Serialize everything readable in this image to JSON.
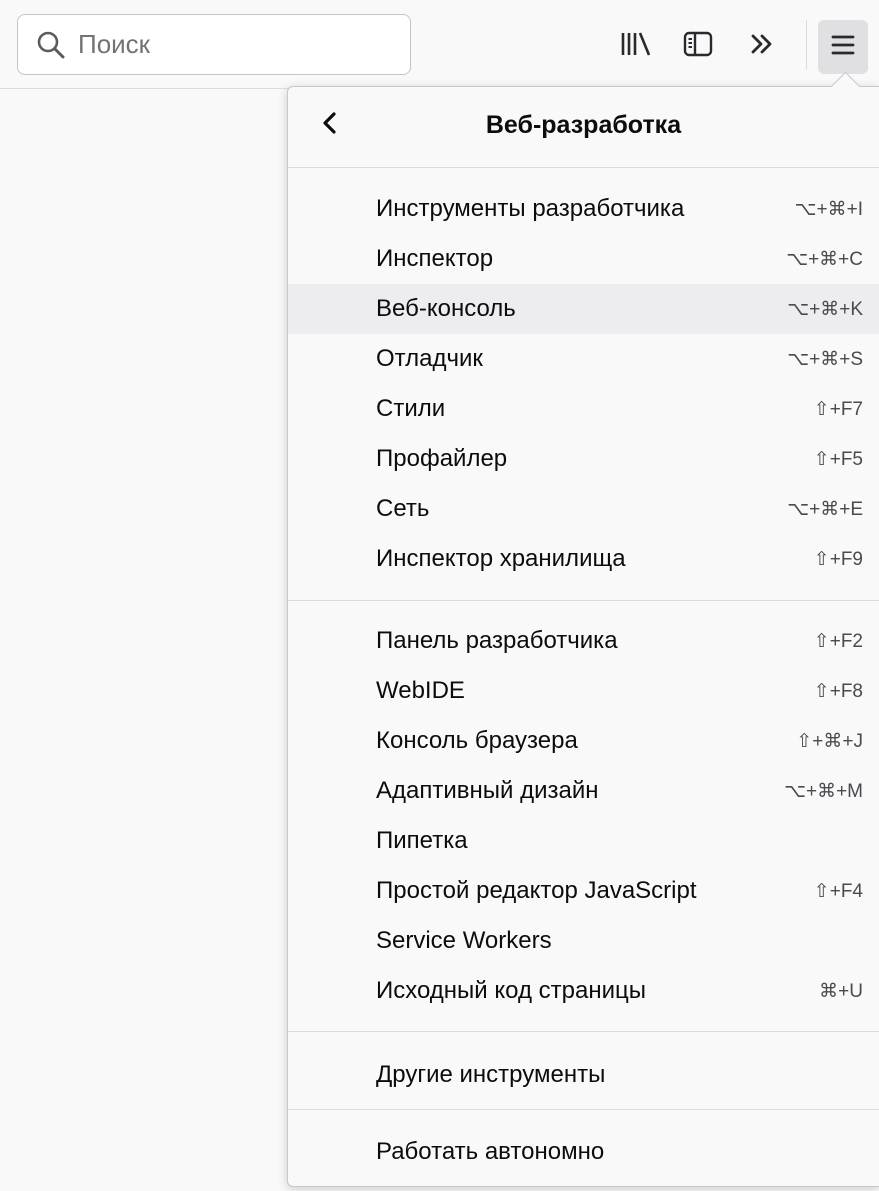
{
  "toolbar": {
    "search_placeholder": "Поиск",
    "icons": [
      "library-icon",
      "sidebar-icon",
      "overflow-chevron-icon",
      "hamburger-menu-icon"
    ]
  },
  "panel": {
    "title": "Веб-разработка",
    "groups": [
      {
        "items": [
          {
            "label": "Инструменты разработчика",
            "shortcut": "⌥+⌘+I"
          },
          {
            "label": "Инспектор",
            "shortcut": "⌥+⌘+C"
          },
          {
            "label": "Веб-консоль",
            "shortcut": "⌥+⌘+K",
            "highlighted": true
          },
          {
            "label": "Отладчик",
            "shortcut": "⌥+⌘+S"
          },
          {
            "label": "Стили",
            "shortcut": "⇧+F7"
          },
          {
            "label": "Профайлер",
            "shortcut": "⇧+F5"
          },
          {
            "label": "Сеть",
            "shortcut": "⌥+⌘+E"
          },
          {
            "label": "Инспектор хранилища",
            "shortcut": "⇧+F9"
          }
        ]
      },
      {
        "items": [
          {
            "label": "Панель разработчика",
            "shortcut": "⇧+F2"
          },
          {
            "label": "WebIDE",
            "shortcut": "⇧+F8"
          },
          {
            "label": "Консоль браузера",
            "shortcut": "⇧+⌘+J"
          },
          {
            "label": "Адаптивный дизайн",
            "shortcut": "⌥+⌘+M"
          },
          {
            "label": "Пипетка",
            "shortcut": ""
          },
          {
            "label": "Простой редактор JavaScript",
            "shortcut": "⇧+F4"
          },
          {
            "label": "Service Workers",
            "shortcut": ""
          },
          {
            "label": "Исходный код страницы",
            "shortcut": "⌘+U"
          }
        ]
      },
      {
        "items": [
          {
            "label": "Другие инструменты",
            "shortcut": ""
          }
        ]
      },
      {
        "items": [
          {
            "label": "Работать автономно",
            "shortcut": ""
          }
        ]
      }
    ]
  },
  "colors": {
    "background": "#f9f9fa",
    "highlight": "#ededf0",
    "separator": "#dcdcde",
    "text": "#0c0c0d",
    "shortcut_text": "#4a4a4f"
  }
}
